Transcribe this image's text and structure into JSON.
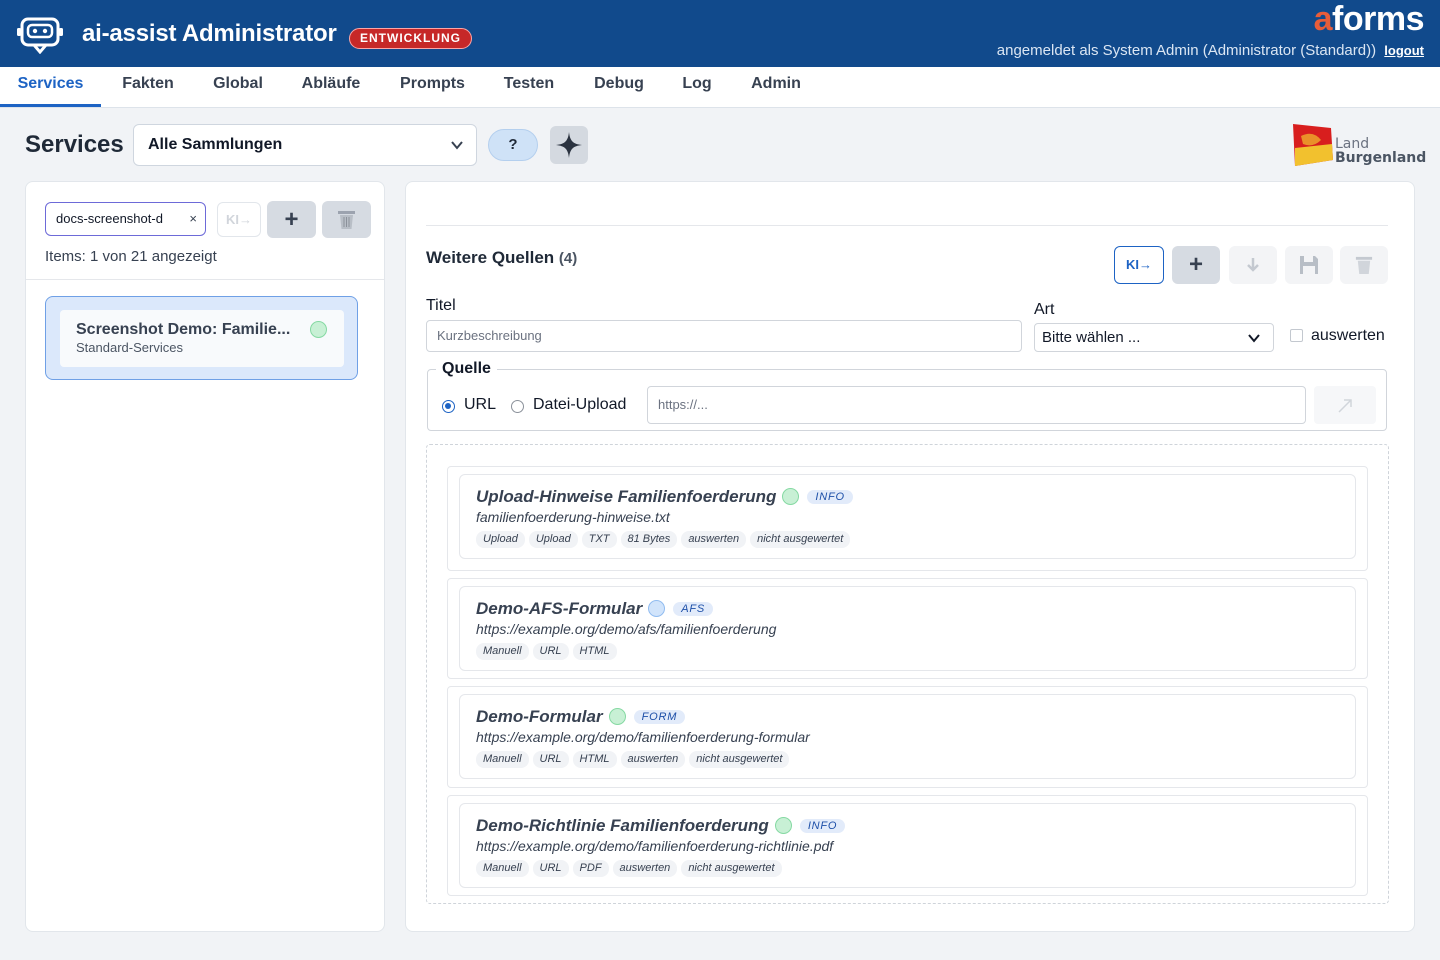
{
  "header": {
    "app_title": "ai-assist Administrator",
    "env_badge": "ENTWICKLUNG",
    "brand_accent": "a",
    "brand_rest": "forms",
    "login_text": "angemeldet als System Admin (Administrator (Standard))",
    "logout_label": "logout"
  },
  "nav": {
    "items": [
      {
        "label": "Services",
        "active": true
      },
      {
        "label": "Fakten"
      },
      {
        "label": "Global"
      },
      {
        "label": "Abläufe"
      },
      {
        "label": "Prompts"
      },
      {
        "label": "Testen"
      },
      {
        "label": "Debug"
      },
      {
        "label": "Log"
      },
      {
        "label": "Admin"
      }
    ]
  },
  "page": {
    "title": "Services",
    "collection_select": "Alle Sammlungen",
    "help_label": "?",
    "land_line1": "Land",
    "land_line2": "Burgenland"
  },
  "left": {
    "filter_value": "docs-screenshot-d",
    "filter_clear": "×",
    "ki_label": "KI→",
    "add_label": "+",
    "items_count": "Items: 1 von 21 angezeigt",
    "services": [
      {
        "title": "Screenshot Demo: Familie...",
        "subtitle": "Standard-Services",
        "status": "green"
      }
    ]
  },
  "right": {
    "section_title": "Weitere Quellen",
    "section_count": "(4)",
    "ki_label": "KI→",
    "add_label": "+",
    "form": {
      "titel_label": "Titel",
      "titel_placeholder": "Kurzbeschreibung",
      "art_label": "Art",
      "art_value": "Bitte wählen ...",
      "auswerten_label": "auswerten",
      "quelle_legend": "Quelle",
      "radio_url": "URL",
      "radio_upload": "Datei-Upload",
      "url_placeholder": "https://..."
    },
    "sources": [
      {
        "title": "Upload-Hinweise Familienfoerderung",
        "status": "green",
        "type": "INFO",
        "url": "familienfoerderung-hinweise.txt",
        "tags": [
          "Upload",
          "Upload",
          "TXT",
          "81 Bytes",
          "auswerten",
          "nicht ausgewertet"
        ]
      },
      {
        "title": "Demo-AFS-Formular",
        "status": "blue",
        "type": "AFS",
        "url": "https://example.org/demo/afs/familienfoerderung",
        "tags": [
          "Manuell",
          "URL",
          "HTML"
        ]
      },
      {
        "title": "Demo-Formular",
        "status": "green",
        "type": "FORM",
        "url": "https://example.org/demo/familienfoerderung-formular",
        "tags": [
          "Manuell",
          "URL",
          "HTML",
          "auswerten",
          "nicht ausgewertet"
        ]
      },
      {
        "title": "Demo-Richtlinie Familienfoerderung",
        "status": "green",
        "type": "INFO",
        "url": "https://example.org/demo/familienfoerderung-richtlinie.pdf",
        "tags": [
          "Manuell",
          "URL",
          "PDF",
          "auswerten",
          "nicht ausgewertet"
        ]
      }
    ]
  },
  "colors": {
    "header_bg": "#114a8c",
    "accent": "#1d63c4",
    "brand_accent": "#e85d3a",
    "env_badge_bg": "#c62828"
  },
  "icons": [
    "robot-logo-icon",
    "chevron-down-icon",
    "sparkle-icon",
    "trash-icon",
    "download-icon",
    "save-icon",
    "open-link-icon",
    "burgenland-flag-icon"
  ]
}
